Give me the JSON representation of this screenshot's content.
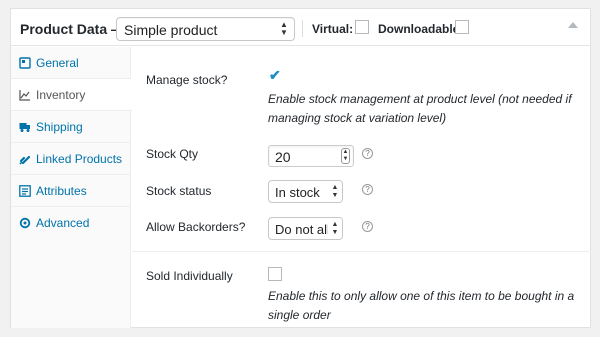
{
  "header": {
    "title": "Product Data —",
    "product_type": "Simple product",
    "virtual_label": "Virtual:",
    "downloadable_label": "Downloadable:"
  },
  "sidebar": {
    "items": [
      {
        "label": "General",
        "icon": "gear-icon",
        "active": false
      },
      {
        "label": "Inventory",
        "icon": "chart-icon",
        "active": true
      },
      {
        "label": "Shipping",
        "icon": "truck-icon",
        "active": false
      },
      {
        "label": "Linked Products",
        "icon": "link-icon",
        "active": false
      },
      {
        "label": "Attributes",
        "icon": "list-icon",
        "active": false
      },
      {
        "label": "Advanced",
        "icon": "gear-icon",
        "active": false
      }
    ]
  },
  "inventory": {
    "manage_stock_label": "Manage stock?",
    "manage_stock_checked": true,
    "manage_stock_desc": "Enable stock management at product level (not needed if managing stock at variation level)",
    "stock_qty_label": "Stock Qty",
    "stock_qty_value": "20",
    "stock_status_label": "Stock status",
    "stock_status_value": "In stock",
    "backorders_label": "Allow Backorders?",
    "backorders_value": "Do not allow",
    "sold_individually_label": "Sold Individually",
    "sold_individually_checked": false,
    "sold_individually_desc": "Enable this to only allow one of this item to be bought in a single order"
  },
  "colors": {
    "link": "#0073aa",
    "active_tab_text": "#555555",
    "checkmark": "#1e8cbe"
  }
}
